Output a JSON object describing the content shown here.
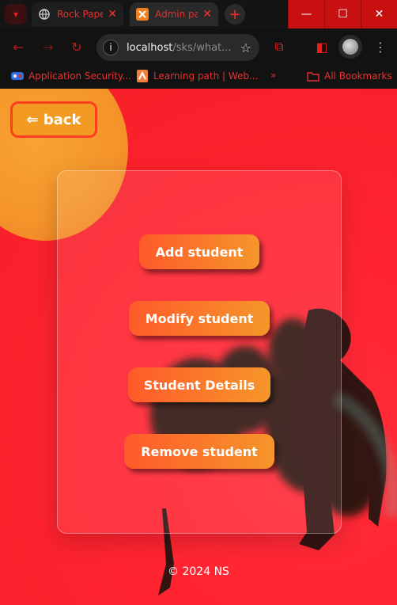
{
  "browser": {
    "tabs": [
      {
        "title": "Rock Paper Scissors",
        "favicon": "globe-icon"
      },
      {
        "title": "Admin page",
        "favicon": "xampp-icon"
      }
    ],
    "address": {
      "host": "localhost",
      "path": "/sks/what..."
    },
    "bookmarks": [
      {
        "label": "Application Security...",
        "icon": "app-security-icon"
      },
      {
        "label": "Learning path | Web...",
        "icon": "learning-path-icon"
      }
    ],
    "bookmarks_overflow": "»",
    "all_bookmarks": "All Bookmarks"
  },
  "page": {
    "back_label": "⇐ back",
    "menu": {
      "add": "Add student",
      "modify": "Modify student",
      "details": "Student Details",
      "remove": "Remove student"
    },
    "footer": "© 2024 NS"
  },
  "colors": {
    "background": "#ff2430",
    "orb": "#f5942a",
    "button_gradient_start": "#ff5a2a",
    "button_gradient_end": "#f5962a",
    "chrome_accent": "#e82020"
  }
}
